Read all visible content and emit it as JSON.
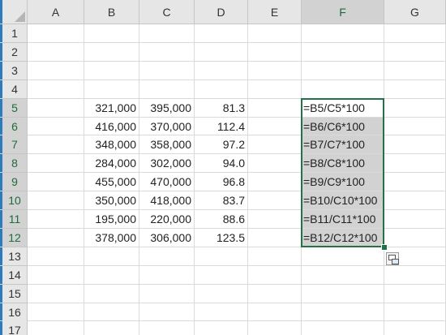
{
  "columns": [
    "A",
    "B",
    "C",
    "D",
    "E",
    "F",
    "G"
  ],
  "rows": [
    "1",
    "2",
    "3",
    "4",
    "5",
    "6",
    "7",
    "8",
    "9",
    "10",
    "11",
    "12",
    "13",
    "14",
    "15",
    "16",
    "17"
  ],
  "selected_column": "F",
  "selected_range": "F5:F12",
  "table": [
    {
      "row": "5",
      "b": "321,000",
      "c": "395,000",
      "d": "81.3",
      "f": "=B5/C5*100"
    },
    {
      "row": "6",
      "b": "416,000",
      "c": "370,000",
      "d": "112.4",
      "f": "=B6/C6*100"
    },
    {
      "row": "7",
      "b": "348,000",
      "c": "358,000",
      "d": "97.2",
      "f": "=B7/C7*100"
    },
    {
      "row": "8",
      "b": "284,000",
      "c": "302,000",
      "d": "94.0",
      "f": "=B8/C8*100"
    },
    {
      "row": "9",
      "b": "455,000",
      "c": "470,000",
      "d": "96.8",
      "f": "=B9/C9*100"
    },
    {
      "row": "10",
      "b": "350,000",
      "c": "418,000",
      "d": "83.7",
      "f": "=B10/C10*100"
    },
    {
      "row": "11",
      "b": "195,000",
      "c": "220,000",
      "d": "88.6",
      "f": "=B11/C11*100"
    },
    {
      "row": "12",
      "b": "378,000",
      "c": "306,000",
      "d": "123.5",
      "f": "=B12/C12*100"
    }
  ],
  "quick_analysis_icon": "quick-analysis-icon",
  "colors": {
    "header_bg": "#e6e6e6",
    "selected_header_bg": "#d2d2d2",
    "selection_border": "#217346",
    "grid": "#dadada"
  }
}
